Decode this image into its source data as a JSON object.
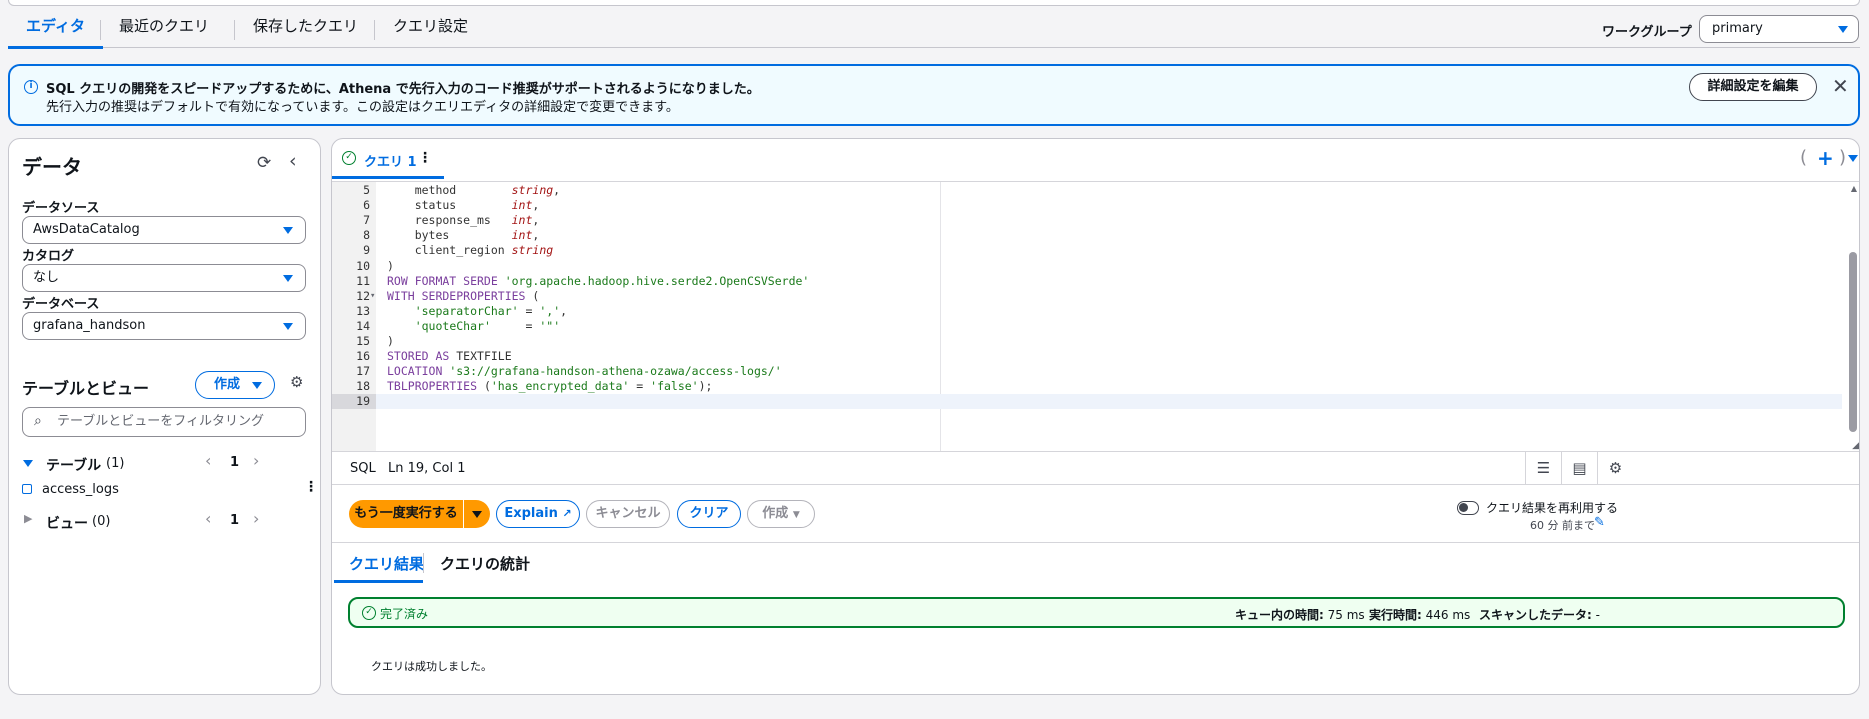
{
  "top_tabs": [
    "エディタ",
    "最近のクエリ",
    "保存したクエリ",
    "クエリ設定"
  ],
  "workgroup": {
    "label": "ワークグループ",
    "value": "primary"
  },
  "banner": {
    "title": "SQL クエリの開発をスピードアップするために、Athena で先行入力のコード推奨がサポートされるようになりました。",
    "body": "先行入力の推奨はデフォルトで有効になっています。この設定はクエリエディタの詳細設定で変更できます。",
    "button": "詳細設定を編集"
  },
  "left": {
    "title": "データ",
    "datasource_label": "データソース",
    "datasource_value": "AwsDataCatalog",
    "catalog_label": "カタログ",
    "catalog_value": "なし",
    "database_label": "データベース",
    "database_value": "grafana_handson",
    "tables_title": "テーブルとビュー",
    "create_button": "作成",
    "filter_placeholder": "テーブルとビューをフィルタリング",
    "tables_section": "テーブル",
    "tables_count": "(1)",
    "tables_page": "1",
    "table_item": "access_logs",
    "views_section": "ビュー",
    "views_count": "(0)",
    "views_page": "1"
  },
  "editor": {
    "query_tab": "クエリ 1",
    "lines": [
      {
        "n": "5",
        "parts": [
          [
            "",
            "    method        "
          ],
          [
            "ty",
            "string"
          ],
          [
            "",
            ","
          ]
        ]
      },
      {
        "n": "6",
        "parts": [
          [
            "",
            "    status        "
          ],
          [
            "ty",
            "int"
          ],
          [
            "",
            ","
          ]
        ]
      },
      {
        "n": "7",
        "parts": [
          [
            "",
            "    response_ms   "
          ],
          [
            "ty",
            "int"
          ],
          [
            "",
            ","
          ]
        ]
      },
      {
        "n": "8",
        "parts": [
          [
            "",
            "    bytes         "
          ],
          [
            "ty",
            "int"
          ],
          [
            "",
            ","
          ]
        ]
      },
      {
        "n": "9",
        "parts": [
          [
            "",
            "    client_region "
          ],
          [
            "ty",
            "string"
          ]
        ]
      },
      {
        "n": "10",
        "parts": [
          [
            "",
            ")"
          ]
        ]
      },
      {
        "n": "11",
        "parts": [
          [
            "kw",
            "ROW FORMAT SERDE "
          ],
          [
            "st",
            "'org.apache.hadoop.hive.serde2.OpenCSVSerde'"
          ]
        ]
      },
      {
        "n": "12",
        "fold": true,
        "parts": [
          [
            "kw",
            "WITH SERDEPROPERTIES"
          ],
          [
            "",
            " ("
          ]
        ]
      },
      {
        "n": "13",
        "parts": [
          [
            "",
            "    "
          ],
          [
            "st",
            "'separatorChar'"
          ],
          [
            "",
            " = "
          ],
          [
            "st",
            "','"
          ],
          [
            "",
            ","
          ]
        ]
      },
      {
        "n": "14",
        "parts": [
          [
            "",
            "    "
          ],
          [
            "st",
            "'quoteChar'"
          ],
          [
            "",
            "     = "
          ],
          [
            "st",
            "'\"'"
          ]
        ]
      },
      {
        "n": "15",
        "parts": [
          [
            "",
            ")"
          ]
        ]
      },
      {
        "n": "16",
        "parts": [
          [
            "kw",
            "STORED AS "
          ],
          [
            "",
            "TEXTFILE"
          ]
        ]
      },
      {
        "n": "17",
        "parts": [
          [
            "kw",
            "LOCATION "
          ],
          [
            "st",
            "'s3://grafana-handson-athena-ozawa/access-logs/'"
          ]
        ]
      },
      {
        "n": "18",
        "parts": [
          [
            "kw",
            "TBLPROPERTIES "
          ],
          [
            "",
            "("
          ],
          [
            "st",
            "'has_encrypted_data'"
          ],
          [
            "",
            " = "
          ],
          [
            "st",
            "'false'"
          ],
          [
            "",
            ");"
          ]
        ]
      },
      {
        "n": "19",
        "active": true,
        "parts": [
          [
            "",
            ""
          ]
        ]
      }
    ],
    "status_lang": "SQL",
    "status_pos": "Ln 19, Col 1"
  },
  "actions": {
    "run": "もう一度実行する",
    "explain": "Explain",
    "cancel": "キャンセル",
    "clear": "クリア",
    "create": "作成",
    "reuse_label": "クエリ結果を再利用する",
    "reuse_sub": "60 分 前まで"
  },
  "results": {
    "tab_results": "クエリ結果",
    "tab_stats": "クエリの統計",
    "status": "完了済み",
    "queue_label": "キュー内の時間:",
    "queue_value": "75 ms",
    "exec_label": "実行時間:",
    "exec_value": "446 ms",
    "scan_label": "スキャンしたデータ:",
    "scan_value": "-",
    "message": "クエリは成功しました。"
  },
  "colors": {
    "accent": "#006ce0",
    "run": "#ff9900",
    "success": "#00802f"
  }
}
